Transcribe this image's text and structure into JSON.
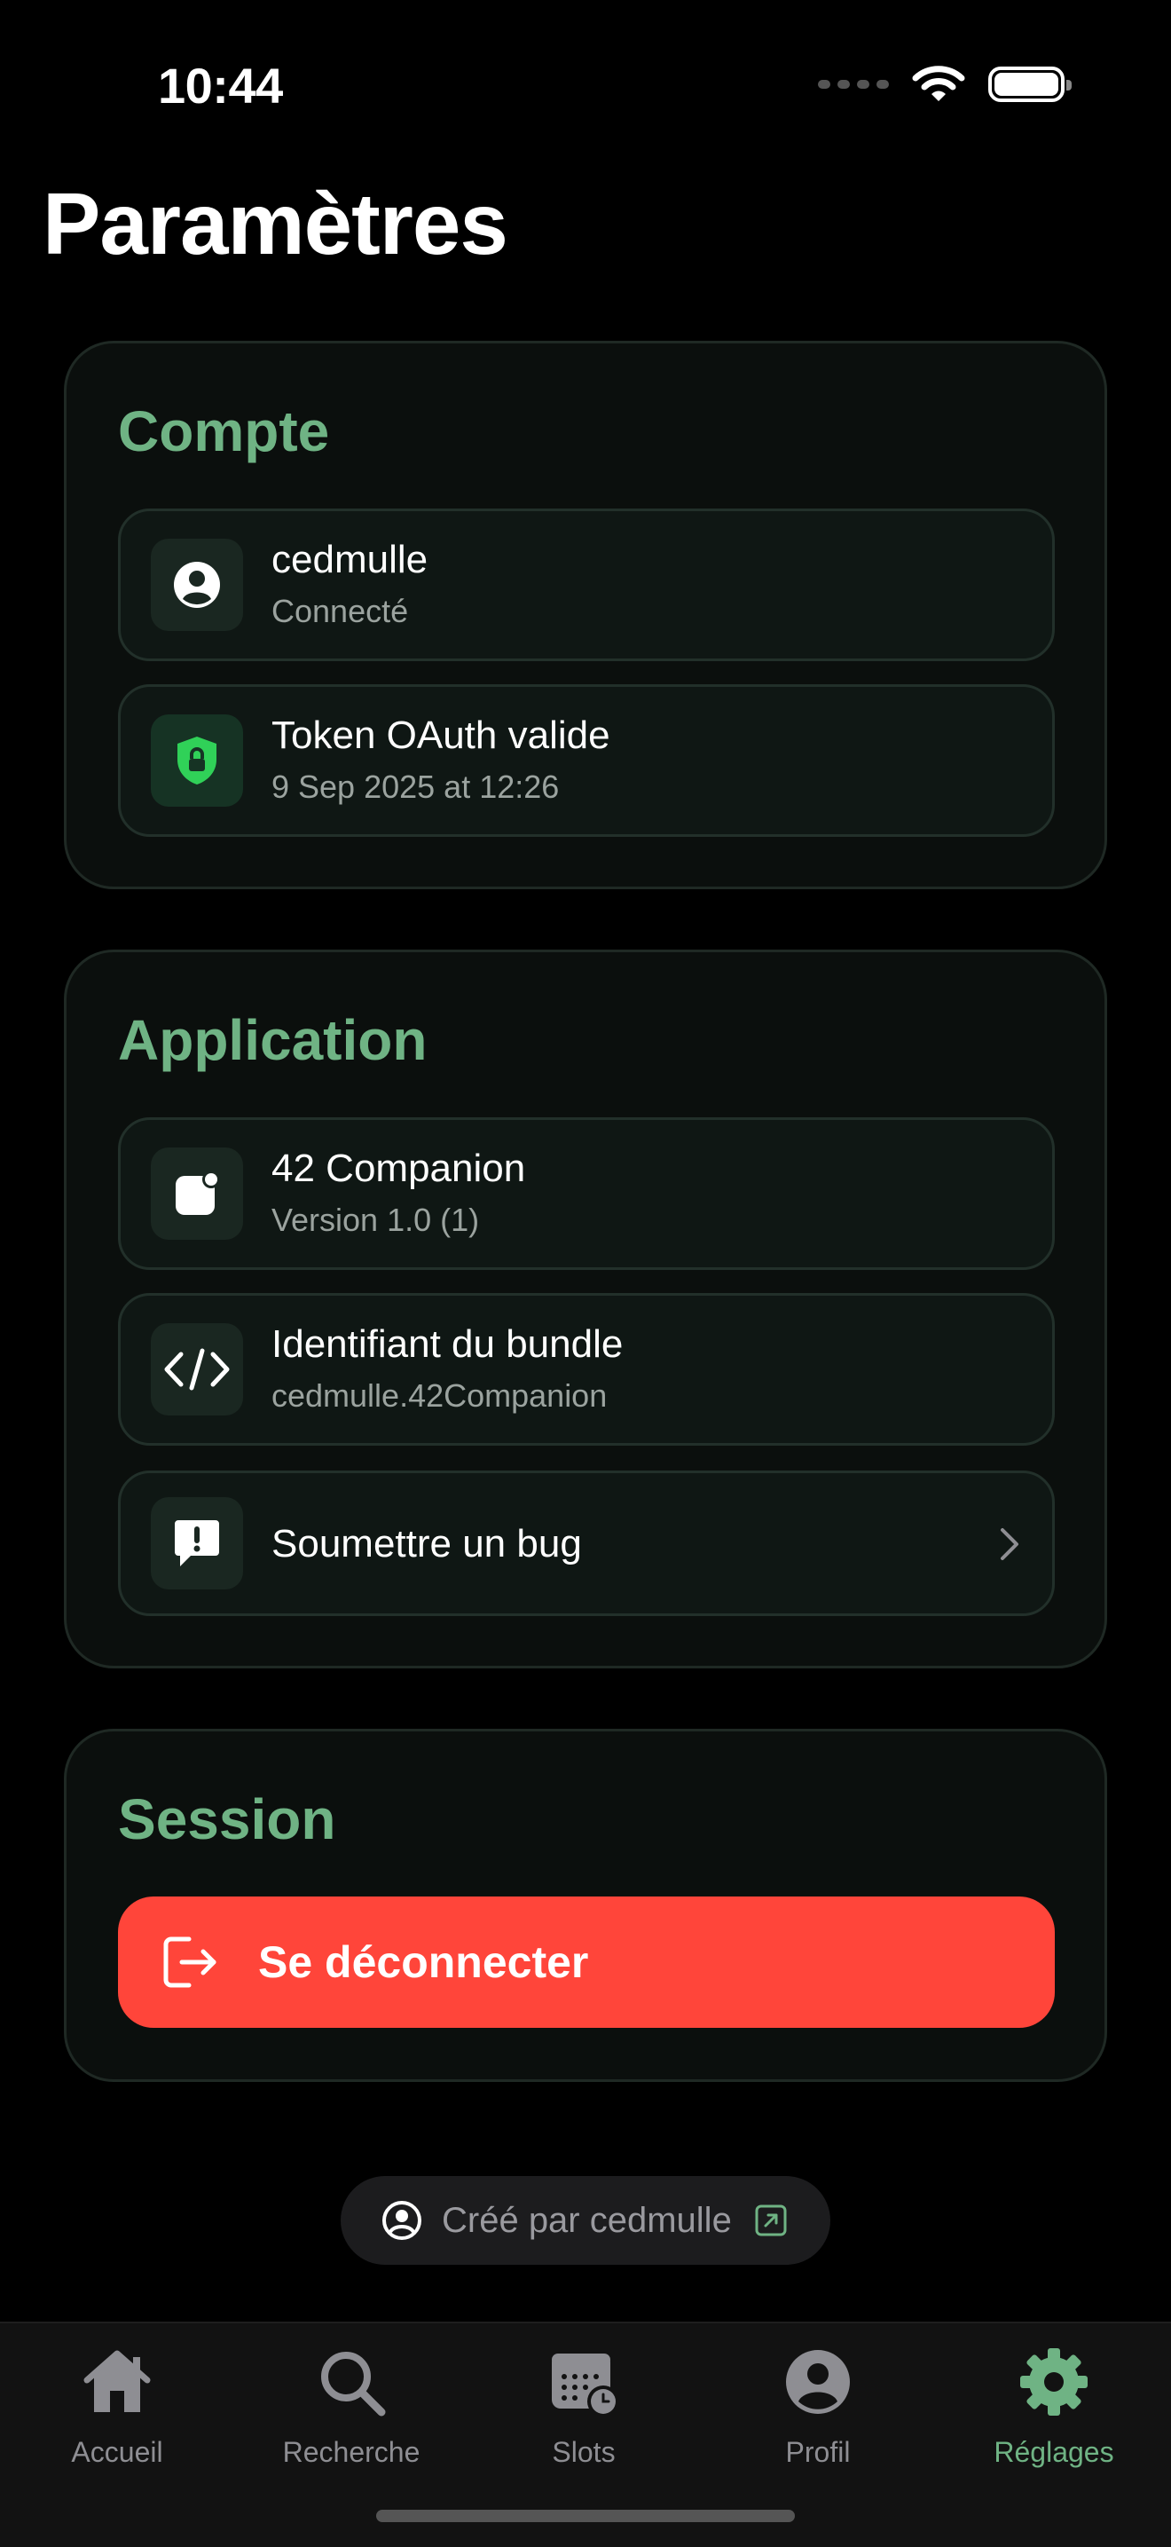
{
  "status_bar": {
    "time": "10:44"
  },
  "page_title": "Paramètres",
  "account": {
    "title": "Compte",
    "user": {
      "name": "cedmulle",
      "status": "Connecté"
    },
    "token": {
      "label": "Token OAuth valide",
      "date": "9 Sep 2025 at 12:26"
    }
  },
  "application": {
    "title": "Application",
    "app": {
      "name": "42 Companion",
      "version": "Version 1.0 (1)"
    },
    "bundle": {
      "label": "Identifiant du bundle",
      "value": "cedmulle.42Companion"
    },
    "bug": {
      "label": "Soumettre un bug"
    }
  },
  "session": {
    "title": "Session",
    "logout_label": "Se déconnecter"
  },
  "credit": {
    "label": "Créé par cedmulle"
  },
  "tabbar": {
    "tabs": [
      {
        "label": "Accueil",
        "icon": "house-icon"
      },
      {
        "label": "Recherche",
        "icon": "magnifier-icon"
      },
      {
        "label": "Slots",
        "icon": "calendar-clock-icon"
      },
      {
        "label": "Profil",
        "icon": "person-circle-icon"
      },
      {
        "label": "Réglages",
        "icon": "gear-icon",
        "active": true
      }
    ]
  },
  "colors": {
    "accent": "#6fb384",
    "danger": "#ff453a",
    "background": "#000000",
    "card": "#0b0f0d",
    "row": "#0f1714",
    "shield_green": "#30d158"
  }
}
